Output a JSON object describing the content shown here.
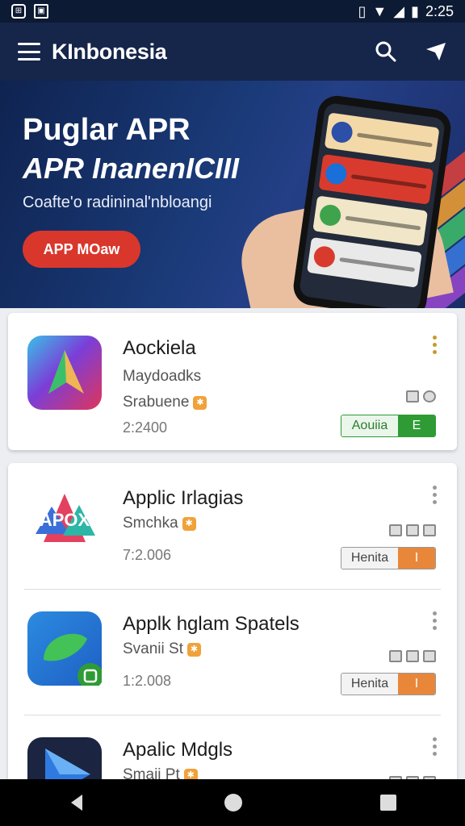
{
  "status_bar": {
    "time": "2:25"
  },
  "app_bar": {
    "title": "KInbonesia"
  },
  "banner": {
    "headline_1": "Puglar APR",
    "headline_2": "APR InanenICIII",
    "subtitle": "Coafte'o radininal'nbloangi",
    "cta_label": "APP MOaw"
  },
  "apps": [
    {
      "name": "Aockiela",
      "developer": "Maydoadks",
      "category": "Srabuene",
      "downloads": "2:2400",
      "button_label": "Aouiia",
      "button_action": "E",
      "button_color": "#2e9b35"
    },
    {
      "name": "Applic Irlagias",
      "developer": "",
      "category": "Smchka",
      "downloads": "7:2.006",
      "button_label": "Henita",
      "button_action": "I",
      "button_color": "#e8873a"
    },
    {
      "name": "Applk hglam Spatels",
      "developer": "",
      "category": "Svanii St",
      "downloads": "1:2.008",
      "button_label": "Henita",
      "button_action": "I",
      "button_color": "#e8873a"
    },
    {
      "name": "Apalic Mdgls",
      "developer": "",
      "category": "Smaii Pt",
      "downloads": "",
      "button_label": "",
      "button_action": "",
      "button_color": "#e8873a"
    }
  ],
  "icons": {
    "menu": "hamburger-icon",
    "search": "search-icon",
    "send": "send-icon",
    "back": "back-icon",
    "home": "home-icon",
    "recents": "recents-icon"
  },
  "colors": {
    "header": "#16254a",
    "status": "#0d1a33",
    "cta": "#d9372c"
  }
}
